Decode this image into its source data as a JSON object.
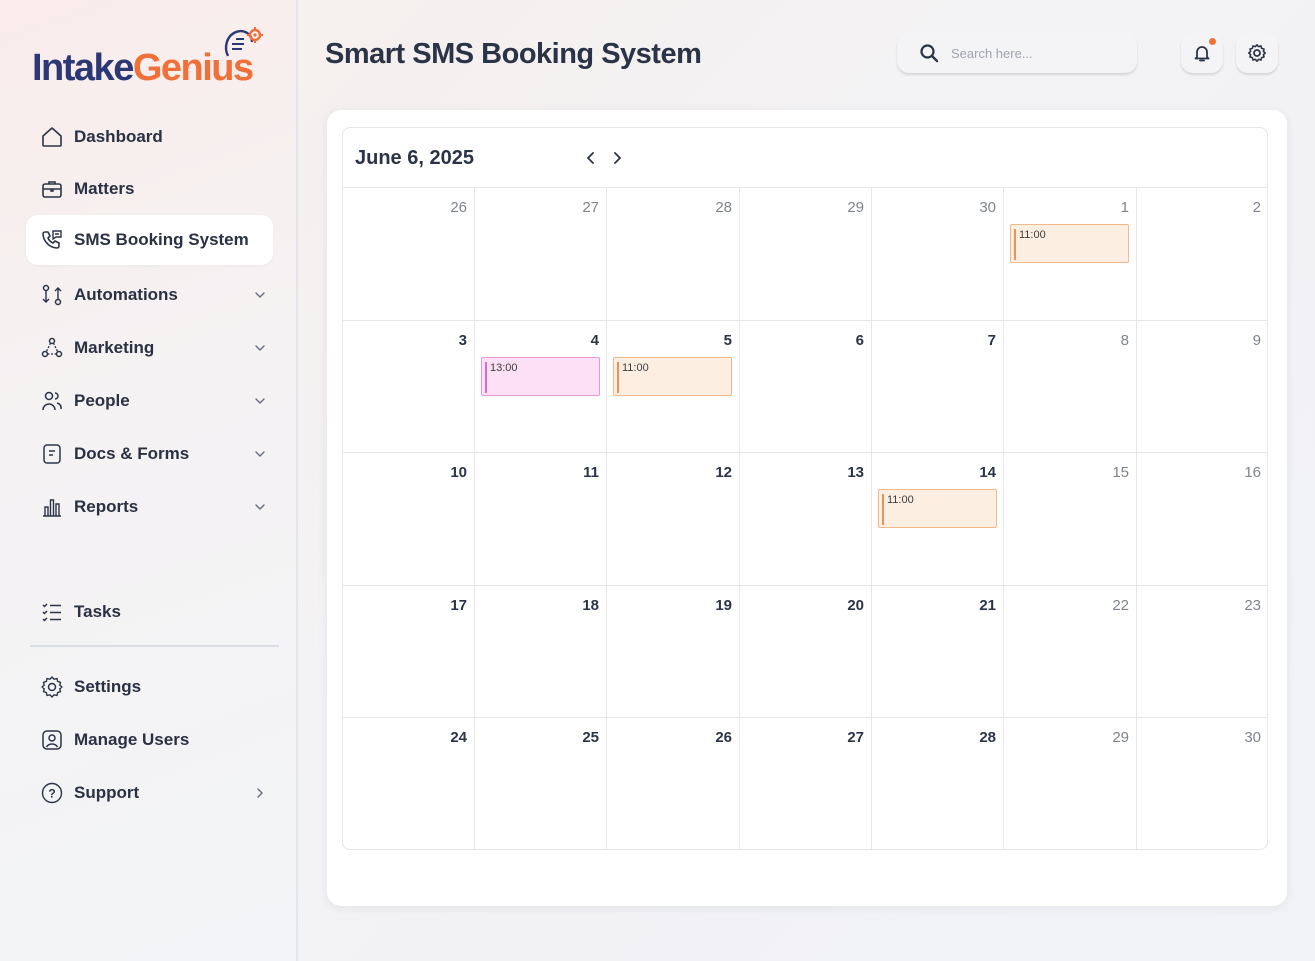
{
  "app": {
    "logo_part1": "Intake",
    "logo_part2": "Genius",
    "page_title": "Smart SMS Booking System"
  },
  "sidebar": {
    "items": [
      {
        "label": "Dashboard",
        "icon": "home-icon",
        "has_chevron": false,
        "active": false
      },
      {
        "label": "Matters",
        "icon": "briefcase-icon",
        "has_chevron": false,
        "active": false
      },
      {
        "label": "SMS Booking System",
        "icon": "phone-chat-icon",
        "has_chevron": false,
        "active": true
      },
      {
        "label": "Automations",
        "icon": "workflow-icon",
        "has_chevron": true,
        "active": false
      },
      {
        "label": "Marketing",
        "icon": "network-icon",
        "has_chevron": true,
        "active": false
      },
      {
        "label": "People",
        "icon": "people-icon",
        "has_chevron": true,
        "active": false
      },
      {
        "label": "Docs & Forms",
        "icon": "document-icon",
        "has_chevron": true,
        "active": false
      },
      {
        "label": "Reports",
        "icon": "bar-chart-icon",
        "has_chevron": true,
        "active": false
      },
      {
        "label": "Tasks",
        "icon": "checklist-icon",
        "has_chevron": false,
        "active": false
      },
      {
        "label": "Settings",
        "icon": "gear-icon",
        "has_chevron": false,
        "active": false
      },
      {
        "label": "Manage Users",
        "icon": "user-icon",
        "has_chevron": false,
        "active": false
      },
      {
        "label": "Support",
        "icon": "help-icon",
        "has_chevron": true,
        "active": false
      }
    ]
  },
  "header": {
    "search_placeholder": "Search here...",
    "icons": [
      "bell-icon",
      "gear-icon"
    ]
  },
  "calendar": {
    "title": "June 6, 2025",
    "weeks": [
      [
        {
          "day": "26",
          "bold": false,
          "events": []
        },
        {
          "day": "27",
          "bold": false,
          "events": []
        },
        {
          "day": "28",
          "bold": false,
          "events": []
        },
        {
          "day": "29",
          "bold": false,
          "events": []
        },
        {
          "day": "30",
          "bold": false,
          "events": []
        },
        {
          "day": "1",
          "bold": false,
          "events": [
            {
              "time": "11:00",
              "color": "orange"
            }
          ]
        },
        {
          "day": "2",
          "bold": false,
          "events": []
        }
      ],
      [
        {
          "day": "3",
          "bold": true,
          "events": []
        },
        {
          "day": "4",
          "bold": true,
          "events": [
            {
              "time": "13:00",
              "color": "pink"
            }
          ]
        },
        {
          "day": "5",
          "bold": true,
          "events": [
            {
              "time": "11:00",
              "color": "orange"
            }
          ]
        },
        {
          "day": "6",
          "bold": true,
          "events": []
        },
        {
          "day": "7",
          "bold": true,
          "events": []
        },
        {
          "day": "8",
          "bold": false,
          "events": []
        },
        {
          "day": "9",
          "bold": false,
          "events": []
        }
      ],
      [
        {
          "day": "10",
          "bold": true,
          "events": []
        },
        {
          "day": "11",
          "bold": true,
          "events": []
        },
        {
          "day": "12",
          "bold": true,
          "events": []
        },
        {
          "day": "13",
          "bold": true,
          "events": []
        },
        {
          "day": "14",
          "bold": true,
          "events": [
            {
              "time": "11:00",
              "color": "orange"
            }
          ]
        },
        {
          "day": "15",
          "bold": false,
          "events": []
        },
        {
          "day": "16",
          "bold": false,
          "events": []
        }
      ],
      [
        {
          "day": "17",
          "bold": true,
          "events": []
        },
        {
          "day": "18",
          "bold": true,
          "events": []
        },
        {
          "day": "19",
          "bold": true,
          "events": []
        },
        {
          "day": "20",
          "bold": true,
          "events": []
        },
        {
          "day": "21",
          "bold": true,
          "events": []
        },
        {
          "day": "22",
          "bold": false,
          "events": []
        },
        {
          "day": "23",
          "bold": false,
          "events": []
        }
      ],
      [
        {
          "day": "24",
          "bold": true,
          "events": []
        },
        {
          "day": "25",
          "bold": true,
          "events": []
        },
        {
          "day": "26",
          "bold": true,
          "events": []
        },
        {
          "day": "27",
          "bold": true,
          "events": []
        },
        {
          "day": "28",
          "bold": true,
          "events": []
        },
        {
          "day": "29",
          "bold": false,
          "events": []
        },
        {
          "day": "30",
          "bold": false,
          "events": []
        }
      ]
    ]
  },
  "colors": {
    "brand_dark": "#2c3875",
    "brand_accent": "#f0703a",
    "event_orange": "#fdeee2",
    "event_pink": "#fce0f6"
  }
}
